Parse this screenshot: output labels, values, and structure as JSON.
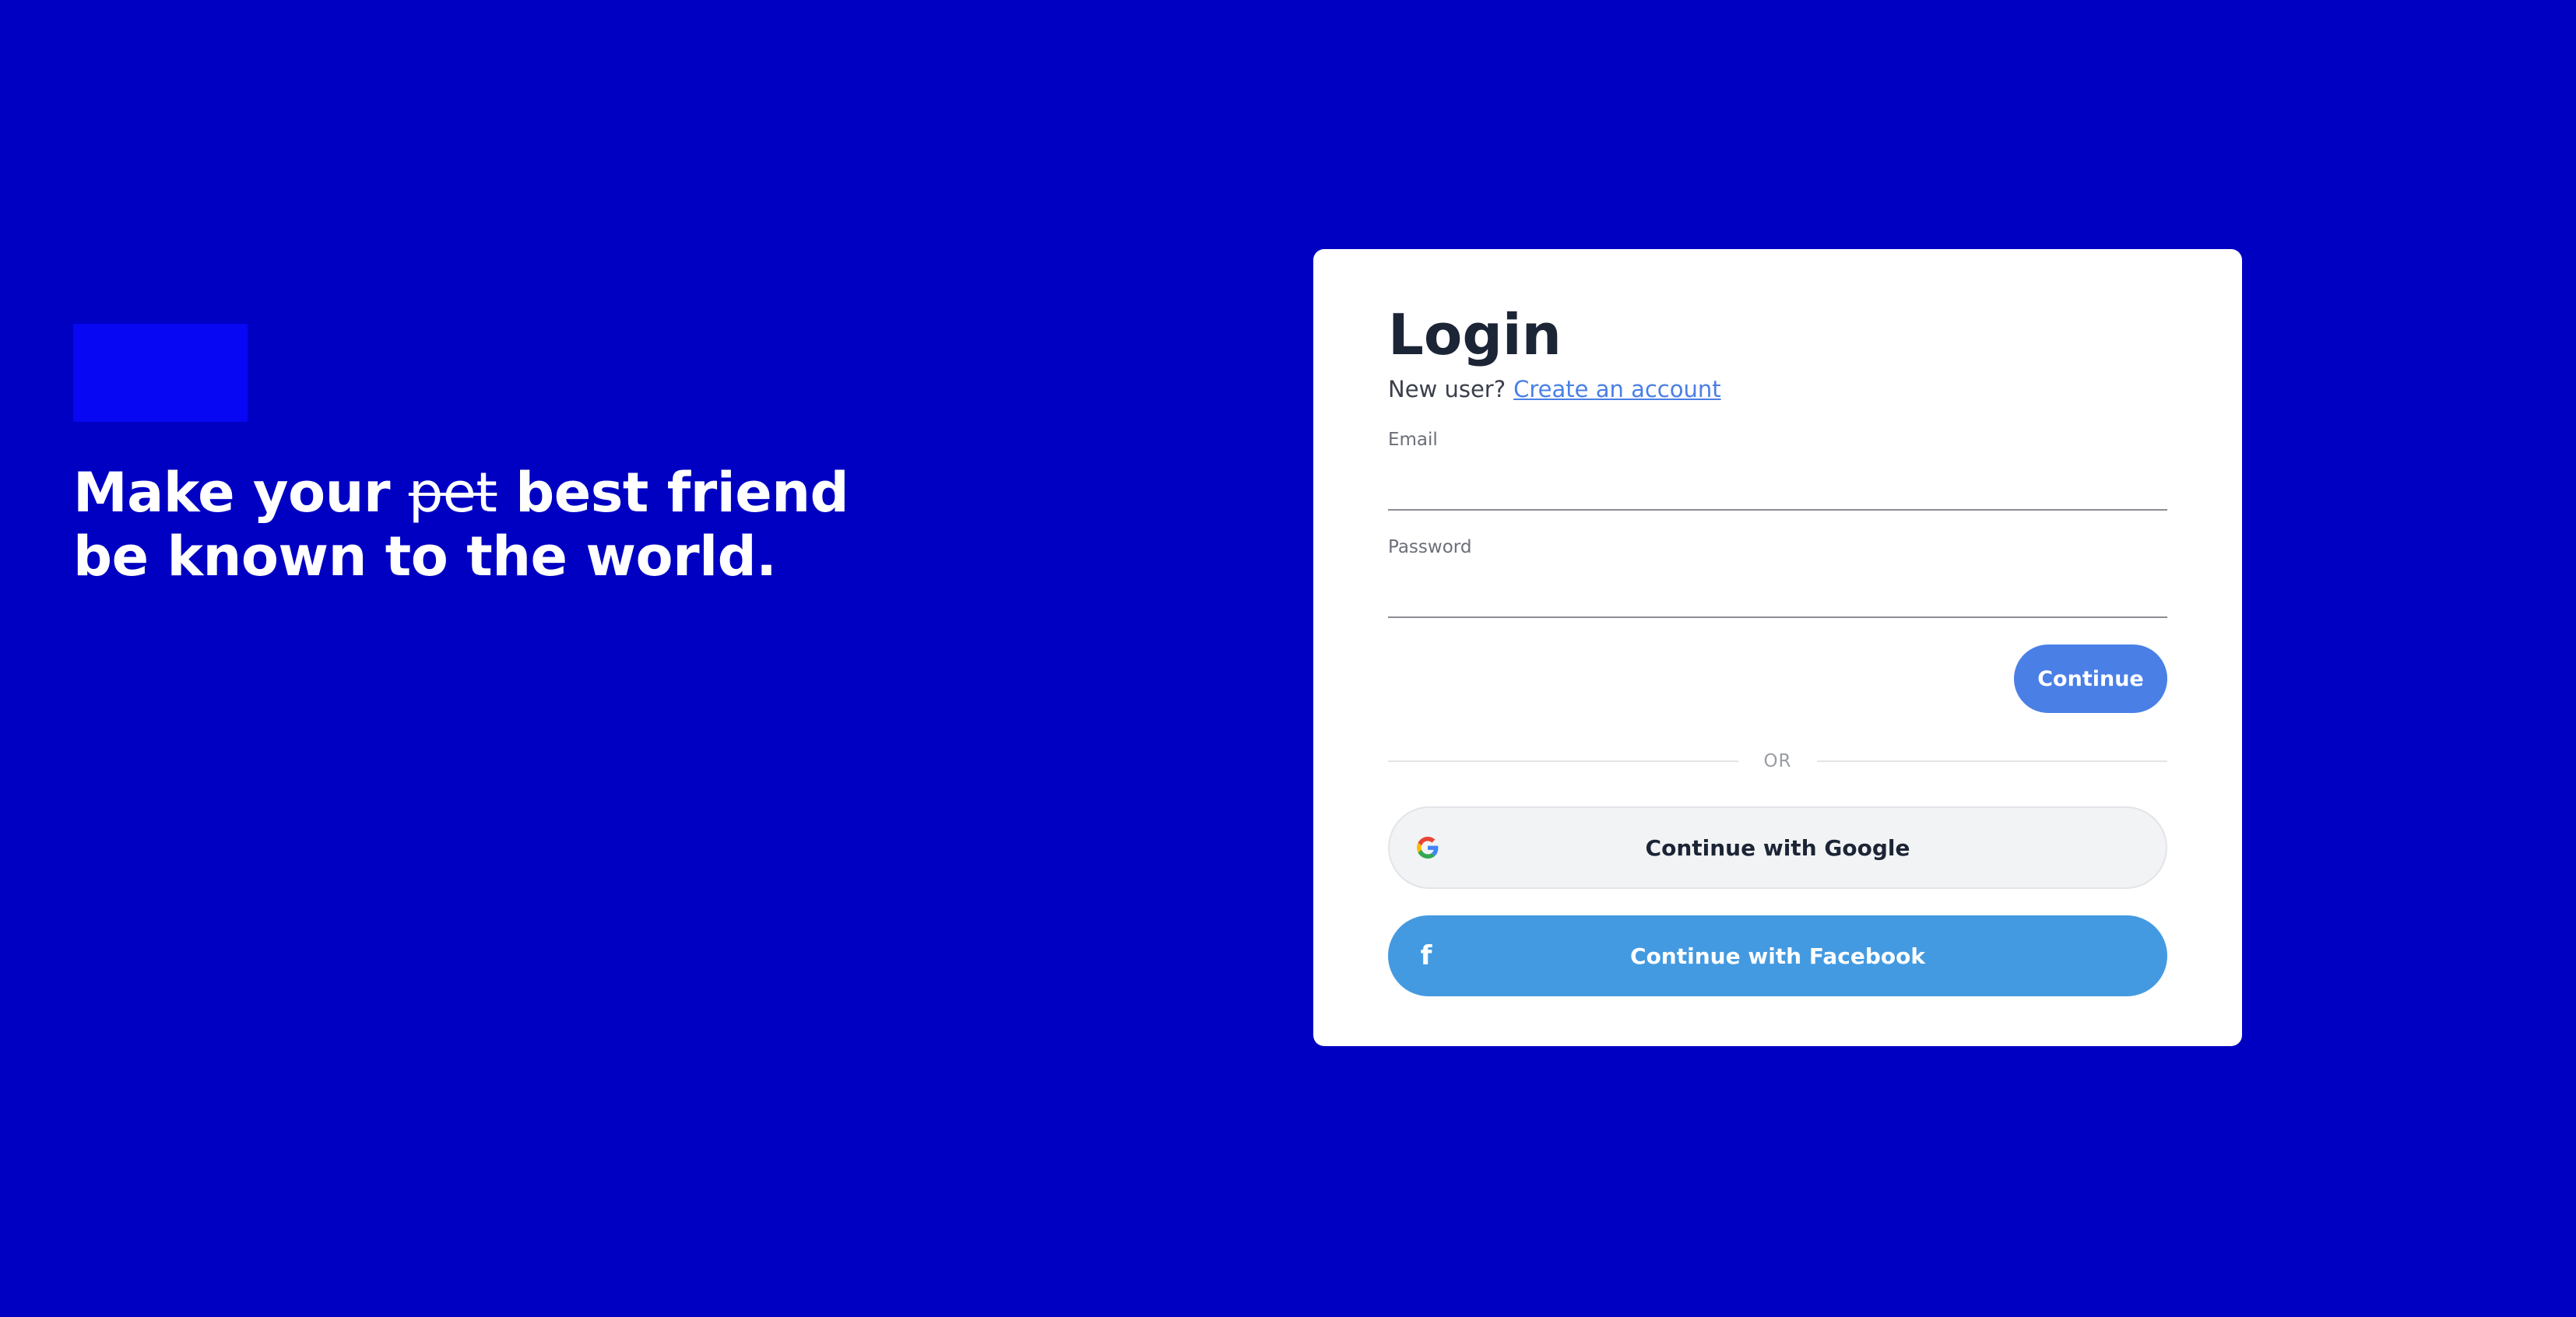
{
  "hero": {
    "tagline_pre": "Make your ",
    "tagline_struck": "pet",
    "tagline_mid": " best friend",
    "tagline_line2": "be known to the world.",
    "logo_color": "#0707f3",
    "background_color": "#0000c3"
  },
  "login": {
    "title": "Login",
    "new_user_text": "New user?",
    "create_account_link": "Create an account",
    "email_label": "Email",
    "email_value": "",
    "password_label": "Password",
    "password_value": "",
    "continue_label": "Continue",
    "divider_text": "OR",
    "google_label": "Continue with Google",
    "google_icon": "google-icon",
    "facebook_label": "Continue with Facebook",
    "facebook_icon": "facebook-icon",
    "accent_color": "#4a7fe6",
    "facebook_color": "#449ae0"
  }
}
